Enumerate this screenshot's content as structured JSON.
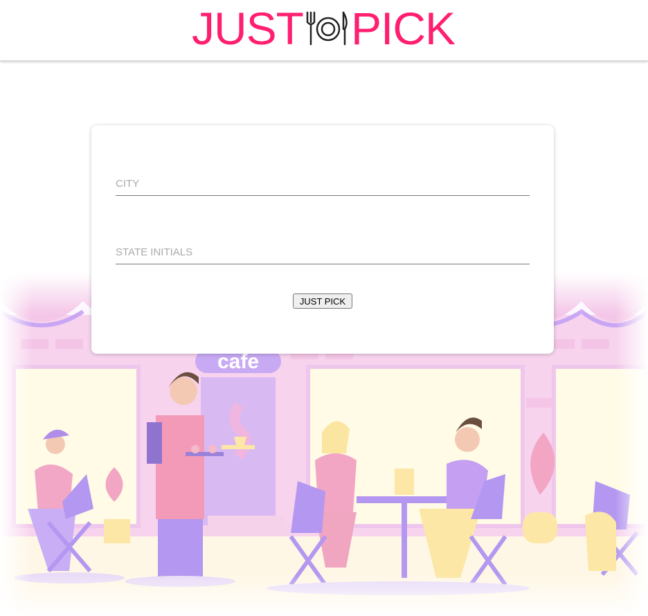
{
  "header": {
    "logo_left": "JUST",
    "logo_right": "PICK",
    "logo_icon": "fork-plate-knife-icon",
    "brand_color": "#ff1f71"
  },
  "form": {
    "city_placeholder": "CITY",
    "city_value": "",
    "state_placeholder": "STATE INITIALS",
    "state_value": "",
    "submit_label": "JUST PICK"
  },
  "illustration": {
    "sign_text": "cafe",
    "palette": {
      "pink": "#f4b8d8",
      "purple": "#b79af0",
      "brick": "#f6c9e6",
      "yellow": "#fdf1c4"
    }
  }
}
